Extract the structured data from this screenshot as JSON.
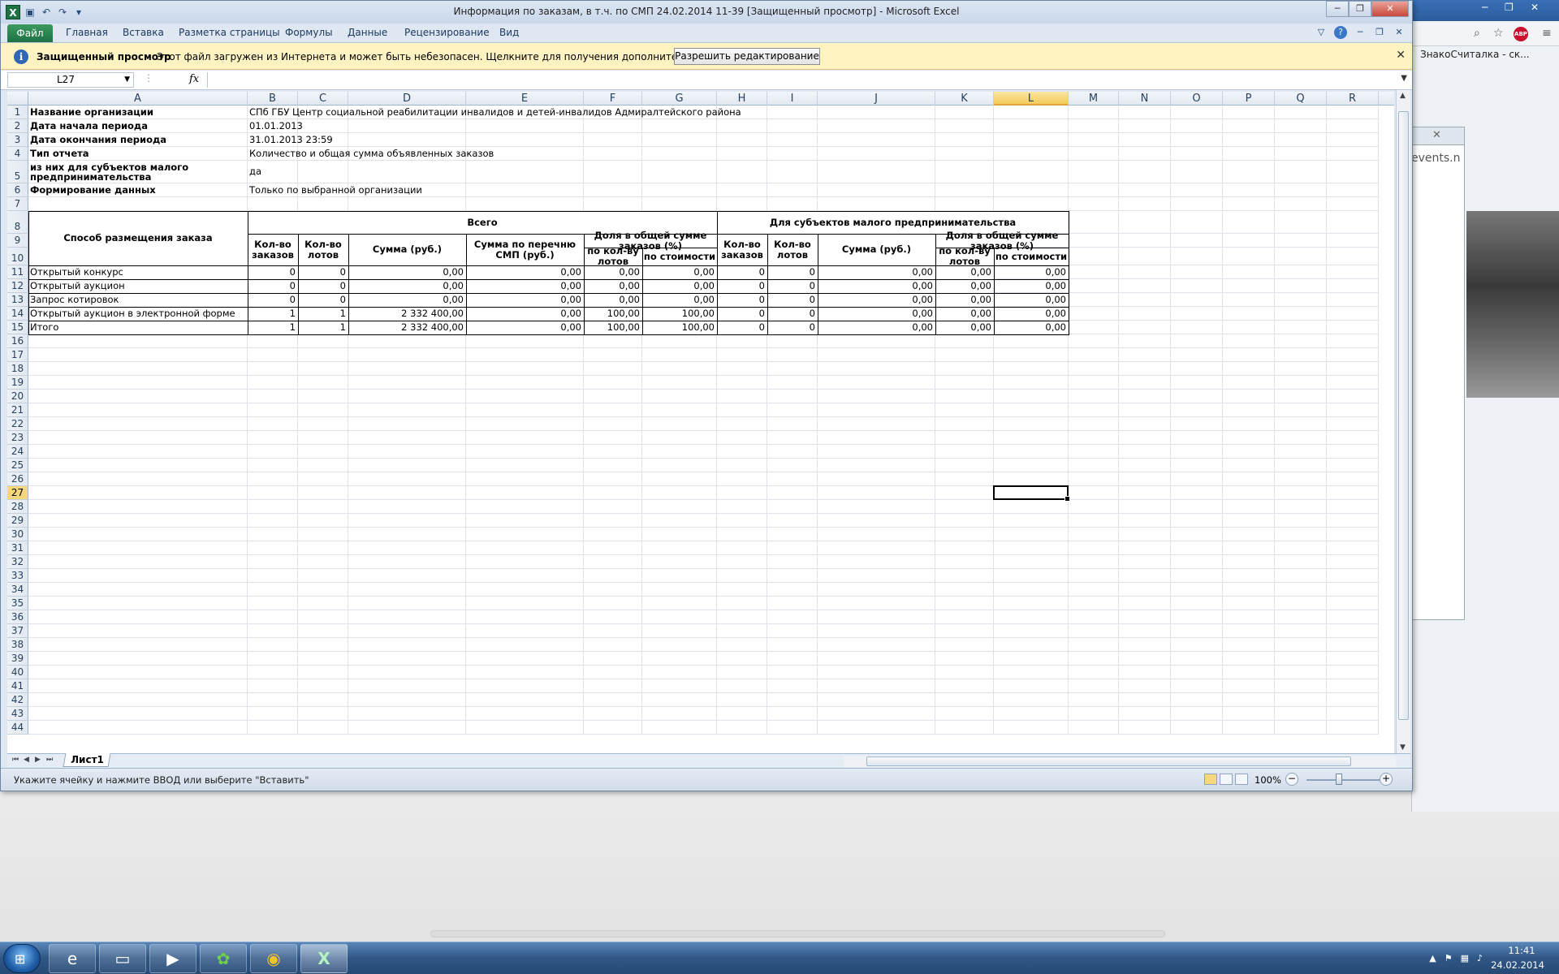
{
  "window": {
    "title": "Информация по заказам, в т.ч. по СМП 24.02.2014 11-39  [Защищенный просмотр]  - Microsoft Excel",
    "minimize": "─",
    "restore": "❐",
    "close": "✕"
  },
  "ribbon": {
    "tabs": [
      "Файл",
      "Главная",
      "Вставка",
      "Разметка страницы",
      "Формулы",
      "Данные",
      "Рецензирование",
      "Вид"
    ]
  },
  "protected_view": {
    "title": "Защищенный просмотр",
    "message": "Этот файл загружен из Интернета и может быть небезопасен. Щелкните для получения дополнительных сведений.",
    "button": "Разрешить редактирование"
  },
  "formula_bar": {
    "name_box": "L27",
    "fx": "fx",
    "value": ""
  },
  "columns": [
    "A",
    "B",
    "C",
    "D",
    "E",
    "F",
    "G",
    "H",
    "I",
    "J",
    "K",
    "L",
    "M",
    "N",
    "O",
    "P",
    "Q",
    "R"
  ],
  "selected_column": "L",
  "selected_row": "27",
  "rows": [
    "1",
    "2",
    "3",
    "4",
    "5",
    "6",
    "7",
    "8",
    "9",
    "10",
    "11",
    "12",
    "13",
    "14",
    "15",
    "16",
    "17",
    "18",
    "19",
    "20",
    "21",
    "22",
    "23",
    "24",
    "25",
    "26",
    "27",
    "28",
    "29",
    "30",
    "31",
    "32",
    "33",
    "34",
    "35",
    "36",
    "37",
    "38",
    "39",
    "40",
    "41",
    "42",
    "43",
    "44"
  ],
  "info": [
    {
      "label": "Название организации",
      "value": "СПб ГБУ Центр социальной реабилитации инвалидов и детей-инвалидов Адмиралтейского района"
    },
    {
      "label": "Дата начала периода",
      "value": "01.01.2013"
    },
    {
      "label": "Дата окончания периода",
      "value": "31.01.2013 23:59"
    },
    {
      "label": "Тип отчета",
      "value": "Количество и общая сумма объявленных заказов"
    },
    {
      "label": "из них для субъектов малого предпринимательства",
      "value": "да"
    },
    {
      "label": "Формирование данных",
      "value": "Только по выбранной организации"
    }
  ],
  "table": {
    "method_header": "Способ размещения заказа",
    "group_all": "Всего",
    "group_smp": "Для субъектов малого предпринимательства",
    "h_orders": "Кол-во заказов",
    "h_lots": "Кол-во лотов",
    "h_sum": "Сумма (руб.)",
    "h_sum_smp": "Сумма по перечню СМП (руб.)",
    "h_share": "Доля в общей сумме заказов (%)",
    "h_by_lots": "по кол-ву лотов",
    "h_by_cost": "по стоимости",
    "rows": [
      {
        "name": "Открытый конкурс",
        "vals": [
          "0",
          "0",
          "0,00",
          "0,00",
          "0,00",
          "0,00",
          "0",
          "0",
          "0,00",
          "0,00",
          "0,00"
        ]
      },
      {
        "name": "Открытый аукцион",
        "vals": [
          "0",
          "0",
          "0,00",
          "0,00",
          "0,00",
          "0,00",
          "0",
          "0",
          "0,00",
          "0,00",
          "0,00"
        ]
      },
      {
        "name": "Запрос котировок",
        "vals": [
          "0",
          "0",
          "0,00",
          "0,00",
          "0,00",
          "0,00",
          "0",
          "0",
          "0,00",
          "0,00",
          "0,00"
        ]
      },
      {
        "name": "Открытый аукцион в электронной форме",
        "vals": [
          "1",
          "1",
          "2 332 400,00",
          "0,00",
          "100,00",
          "100,00",
          "0",
          "0",
          "0,00",
          "0,00",
          "0,00"
        ]
      },
      {
        "name": "Итого",
        "vals": [
          "1",
          "1",
          "2 332 400,00",
          "0,00",
          "100,00",
          "100,00",
          "0",
          "0",
          "0,00",
          "0,00",
          "0,00"
        ]
      }
    ]
  },
  "sheet_tab": "Лист1",
  "status": {
    "text": "Укажите ячейку и нажмите ВВОД или выберите \"Вставить\"",
    "zoom": "100%",
    "zoom_minus": "−",
    "zoom_plus": "+"
  },
  "browser": {
    "bookmark": "ЗнакоСчиталка - ск...",
    "panel_text": "events.n",
    "abp": "ABP"
  },
  "taskbar": {
    "time": "11:41",
    "date": "24.02.2014"
  }
}
